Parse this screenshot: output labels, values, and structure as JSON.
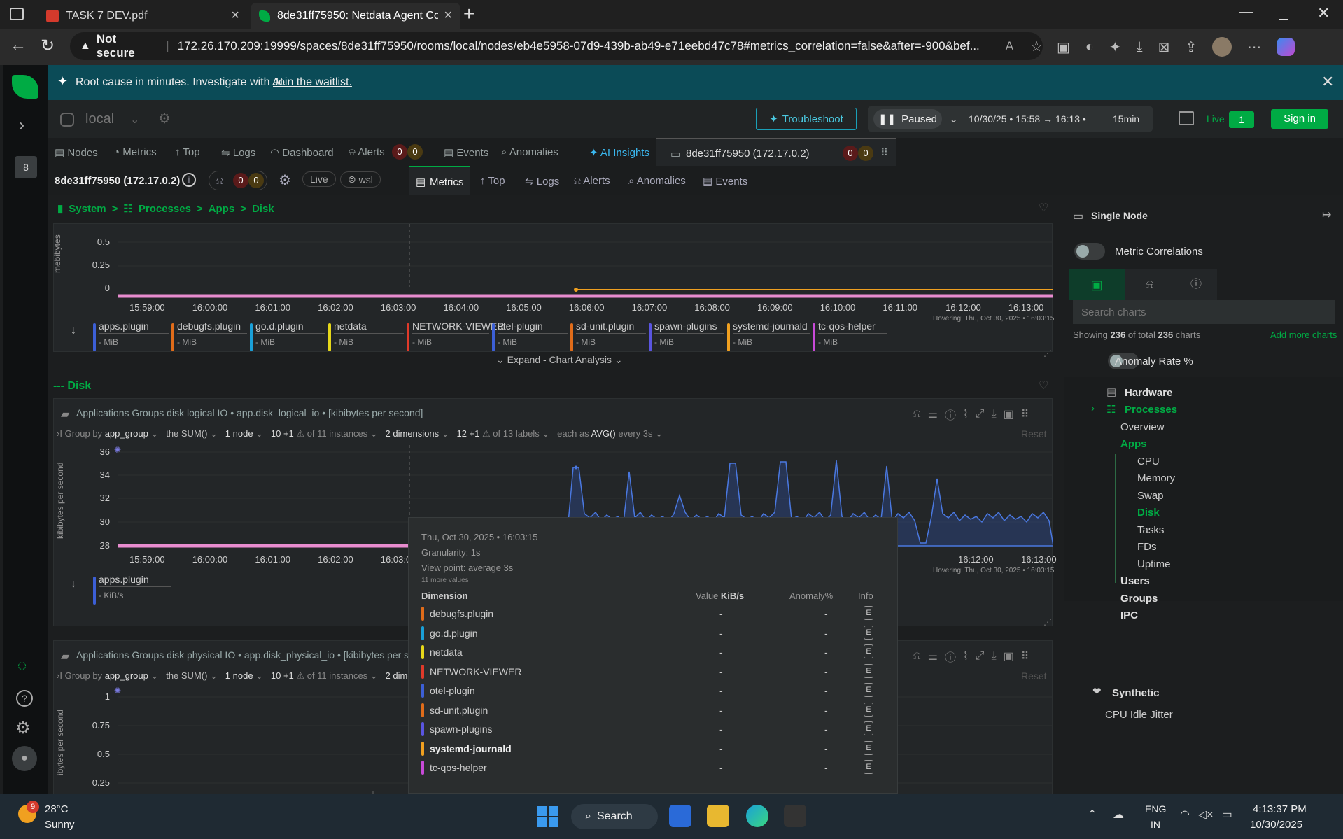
{
  "browser": {
    "tabs": [
      {
        "title": "TASK 7 DEV.pdf"
      },
      {
        "title": "8de31ff75950: Netdata Agent Co"
      }
    ],
    "security_label": "Not secure",
    "url": "172.26.170.209:19999/spaces/8de31ff75950/rooms/local/nodes/eb4e5958-07d9-439b-ab49-e71eebd47c78#metrics_correlation=false&after=-900&bef..."
  },
  "banner": {
    "text": "Root cause in minutes. Investigate with AI.",
    "link": "Join the waitlist."
  },
  "rail": {
    "badge": "8"
  },
  "topbar": {
    "room": "local",
    "troubleshoot": "Troubleshoot",
    "paused": "Paused",
    "timerange": "10/30/25 • 15:58 → 16:13 •",
    "duration": "15min",
    "live": "Live",
    "live_count": "1",
    "signin": "Sign in"
  },
  "navtabs": [
    {
      "label": "Nodes"
    },
    {
      "label": "Metrics"
    },
    {
      "label": "Top"
    },
    {
      "label": "Logs"
    },
    {
      "label": "Dashboard"
    },
    {
      "label": "Alerts"
    },
    {
      "label": "Events"
    },
    {
      "label": "Anomalies"
    },
    {
      "label": "AI Insights"
    }
  ],
  "alerts_counts": {
    "a": "0",
    "b": "0"
  },
  "node_tab": {
    "label": "8de31ff75950 (172.17.0.2)",
    "a": "0",
    "b": "0"
  },
  "nodebar": {
    "node": "8de31ff75950 (172.17.0.2)",
    "a": "0",
    "b": "0",
    "live": "Live",
    "wsl": "wsl",
    "tabs": [
      {
        "label": "Metrics"
      },
      {
        "label": "Top"
      },
      {
        "label": "Logs"
      },
      {
        "label": "Alerts"
      },
      {
        "label": "Anomalies"
      },
      {
        "label": "Events"
      }
    ]
  },
  "breadcrumb": {
    "system": "System",
    "processes": "Processes",
    "apps": "Apps",
    "disk": "Disk",
    "sep": ">"
  },
  "chart1": {
    "ylabel": "mebibytes",
    "yticks": [
      "0.5",
      "0.25",
      "0"
    ],
    "xticks": [
      "15:59:00",
      "16:00:00",
      "16:01:00",
      "16:02:00",
      "16:03:00",
      "16:04:00",
      "16:05:00",
      "16:06:00",
      "16:07:00",
      "16:08:00",
      "16:09:00",
      "16:10:00",
      "16:11:00",
      "16:12:00",
      "16:13:00"
    ],
    "hover": "Hovering: Thu, Oct 30, 2025 • 16:03:15",
    "legend": [
      {
        "name": "apps.plugin",
        "unit": "MiB",
        "color": "#3c5fd6"
      },
      {
        "name": "debugfs.plugin",
        "unit": "MiB",
        "color": "#e06c1a"
      },
      {
        "name": "go.d.plugin",
        "unit": "MiB",
        "color": "#1aa0d8"
      },
      {
        "name": "netdata",
        "unit": "MiB",
        "color": "#e6d81a"
      },
      {
        "name": "NETWORK-VIEWER",
        "unit": "MiB",
        "color": "#e03a2a"
      },
      {
        "name": "otel-plugin",
        "unit": "MiB",
        "color": "#3c5fd6"
      },
      {
        "name": "sd-unit.plugin",
        "unit": "MiB",
        "color": "#e06c1a"
      },
      {
        "name": "spawn-plugins",
        "unit": "MiB",
        "color": "#5a55e0"
      },
      {
        "name": "systemd-journald",
        "unit": "MiB",
        "color": "#f0a020"
      },
      {
        "name": "tc-qos-helper",
        "unit": "MiB",
        "color": "#c84ad8"
      }
    ],
    "value_dash": "-",
    "expand": "Expand - Chart Analysis"
  },
  "section_disk": "--- Disk",
  "chart2": {
    "title": "Applications Groups disk logical IO • app.disk_logical_io • [kibibytes per second]",
    "groupby": "Group by",
    "groupval": "app_group",
    "agg": "the SUM()",
    "nodes": "1 node",
    "inst": "10 +1",
    "inst_of": "of 11 instances",
    "dims": "2 dimensions",
    "labels": "12 +1",
    "labels_of": "of 13 labels",
    "each": "each as",
    "avg": "AVG()",
    "every": "every 3s",
    "reset": "Reset",
    "ylabel": "kibibytes per second",
    "yticks": [
      "36",
      "34",
      "32",
      "30",
      "28"
    ],
    "xticks_left": [
      "15:59:00",
      "16:00:00",
      "16:01:00",
      "16:02:00",
      "16:03:00"
    ],
    "xticks_right": [
      "00",
      "16:12:00",
      "16:13:00"
    ],
    "hover": "Hovering: Thu, Oct 30, 2025 • 16:03:15",
    "legend_name": "apps.plugin",
    "legend_unit": "KiB/s",
    "value_dash": "-"
  },
  "chart3": {
    "title": "Applications Groups disk physical IO • app.disk_physical_io • [kibibytes per sec",
    "groupby": "Group by",
    "groupval": "app_group",
    "agg": "the SUM()",
    "nodes": "1 node",
    "inst": "10 +1",
    "inst_of": "of 11 instances",
    "dims": "2 dime",
    "reset": "Reset",
    "ylabel": "ibytes per second",
    "yticks": [
      "1",
      "0.75",
      "0.5",
      "0.25"
    ]
  },
  "tooltip": {
    "date": "Thu, Oct 30, 2025 • 16:03:15",
    "granularity": "Granularity: 1s",
    "viewpoint": "View point: average 3s",
    "more": "11 more values",
    "h_dim": "Dimension",
    "h_value": "Value",
    "h_unit": "KiB/s",
    "h_anom": "Anomaly%",
    "h_info": "Info",
    "rows": [
      {
        "name": "debugfs.plugin",
        "color": "#e06c1a",
        "value": "-",
        "anom": "-",
        "info": "E"
      },
      {
        "name": "go.d.plugin",
        "color": "#1aa0d8",
        "value": "-",
        "anom": "-",
        "info": "E"
      },
      {
        "name": "netdata",
        "color": "#e6d81a",
        "value": "-",
        "anom": "-",
        "info": "E"
      },
      {
        "name": "NETWORK-VIEWER",
        "color": "#e03a2a",
        "value": "-",
        "anom": "-",
        "info": "E"
      },
      {
        "name": "otel-plugin",
        "color": "#3c5fd6",
        "value": "-",
        "anom": "-",
        "info": "E"
      },
      {
        "name": "sd-unit.plugin",
        "color": "#e06c1a",
        "value": "-",
        "anom": "-",
        "info": "E"
      },
      {
        "name": "spawn-plugins",
        "color": "#5a55e0",
        "value": "-",
        "anom": "-",
        "info": "E"
      },
      {
        "name": "systemd-journald",
        "color": "#f0a020",
        "value": "-",
        "anom": "-",
        "info": "E"
      },
      {
        "name": "tc-qos-helper",
        "color": "#c84ad8",
        "value": "-",
        "anom": "-",
        "info": "E"
      }
    ]
  },
  "sidebar": {
    "title": "Single Node",
    "metric_corr": "Metric Correlations",
    "search_placeholder": "Search charts",
    "showing_pre": "Showing",
    "showing_n": "236",
    "showing_mid": "of total",
    "showing_total": "236",
    "showing_post": "charts",
    "add_more": "Add more charts",
    "anomaly": "Anomaly Rate %",
    "tree": {
      "hardware": "Hardware",
      "processes": "Processes",
      "overview": "Overview",
      "apps": "Apps",
      "cpu": "CPU",
      "memory": "Memory",
      "swap": "Swap",
      "disk": "Disk",
      "tasks": "Tasks",
      "fds": "FDs",
      "uptime": "Uptime",
      "users": "Users",
      "groups": "Groups",
      "ipc": "IPC",
      "synthetic": "Synthetic",
      "cpu_idle": "CPU Idle Jitter"
    }
  },
  "taskbar": {
    "weather_badge": "9",
    "temp": "28°C",
    "cond": "Sunny",
    "search": "Search",
    "lang1": "ENG",
    "lang2": "IN",
    "time": "4:13:37 PM",
    "date": "10/30/2025"
  },
  "colors": {
    "accent": "#00ab44",
    "banner": "#0b4b57",
    "pink_line": "#e88ccf",
    "orange_line": "#f0a020",
    "area": "#2c4a8a"
  }
}
